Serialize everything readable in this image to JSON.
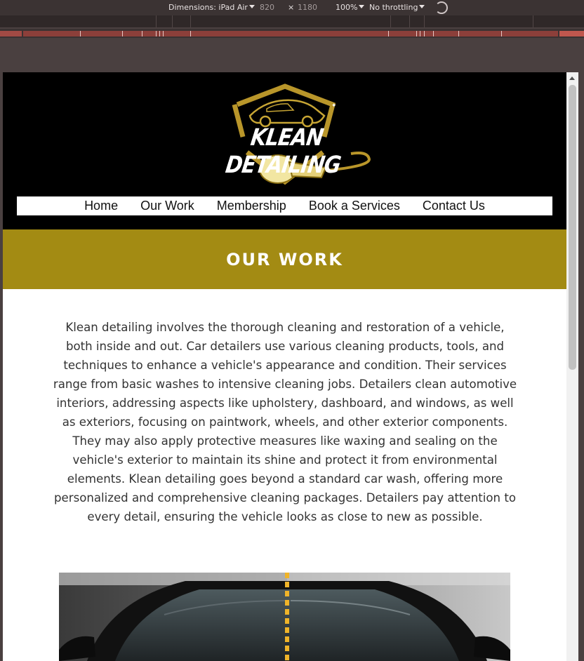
{
  "devtools": {
    "dimensions_label": "Dimensions: iPad Air",
    "width": "820",
    "times": "×",
    "height": "1180",
    "zoom": "100%",
    "throttling": "No throttling",
    "rotate_icon": "rotate-icon"
  },
  "site": {
    "logo_text": "KLEAN DETAILING",
    "nav": [
      "Home",
      "Our Work",
      "Membership",
      "Book a Services",
      "Contact Us"
    ],
    "banner_title": "OUR WORK",
    "intro": "Klean detailing involves the thorough cleaning and restoration of a vehicle, both inside and out. Car detailers use various cleaning products, tools, and techniques to enhance a vehicle's appearance and condition. Their services range from basic washes to intensive cleaning jobs. Detailers clean automotive interiors, addressing aspects like upholstery, dashboard, and windows, as well as exteriors, focusing on paintwork, wheels, and other exterior components. They may also apply protective measures like waxing and sealing on the vehicle's exterior to maintain its shine and protect it from environmental elements. Klean detailing goes beyond a standard car wash, offering more personalized and comprehensive cleaning packages. Detailers pay attention to every detail, ensuring the vehicle looks as close to new as possible."
  },
  "colors": {
    "header_bg": "#000000",
    "gold": "#a38b13",
    "logo_gold": "#b9962a",
    "slider_handle": "#f0b429"
  }
}
